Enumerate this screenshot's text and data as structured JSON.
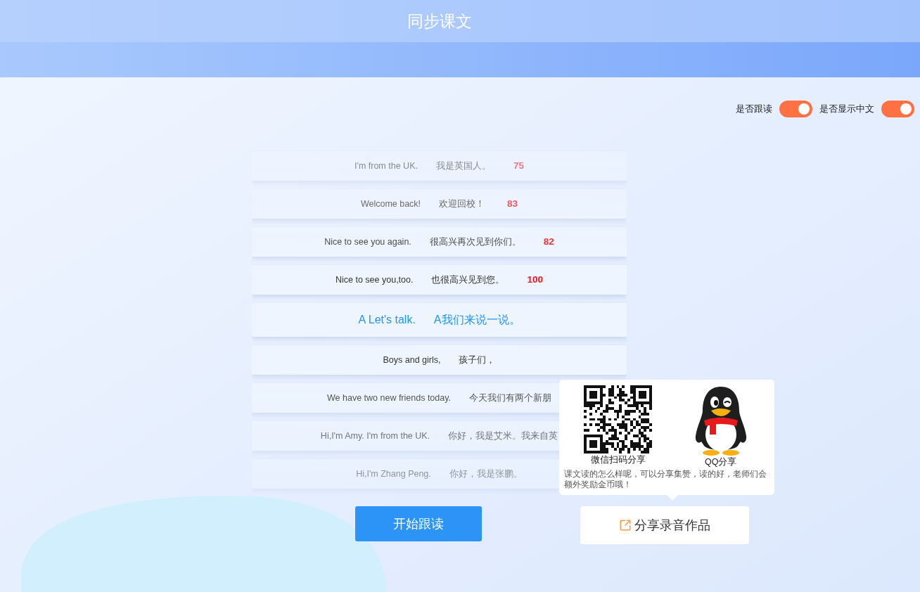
{
  "header": {
    "title": "同步课文"
  },
  "toggles": [
    {
      "label": "是否跟读",
      "on": true
    },
    {
      "label": "是否显示中文",
      "on": true
    }
  ],
  "lines": [
    {
      "kind": "sentence",
      "en": "I'm from the UK.",
      "zh": "我是英国人。",
      "score": "75"
    },
    {
      "kind": "sentence",
      "en": "Welcome back!",
      "zh": "欢迎回校！",
      "score": "83"
    },
    {
      "kind": "sentence",
      "en": "Nice to see you again.",
      "zh": "很高兴再次见到你们。",
      "score": "82"
    },
    {
      "kind": "sentence",
      "en": "Nice to see you,too.",
      "zh": "也很高兴见到您。",
      "score": "100"
    },
    {
      "kind": "heading",
      "en": "A Let's talk.",
      "zh": "A我们来说一说。"
    },
    {
      "kind": "sentence",
      "en": "Boys and girls,",
      "zh": "孩子们，"
    },
    {
      "kind": "sentence",
      "en": "We have two new friends today.",
      "zh": "今天我们有两个新朋"
    },
    {
      "kind": "sentence",
      "en": "Hi,I'm Amy. I'm from the UK.",
      "zh": "你好，我是艾米。我来自英"
    },
    {
      "kind": "sentence",
      "en": "Hi,I'm Zhang Peng.",
      "zh": "你好，我是张鹏。"
    }
  ],
  "share_popup": {
    "options": [
      {
        "kind": "qr",
        "label": "微信扫码分享"
      },
      {
        "kind": "qq",
        "label": "QQ分享"
      }
    ],
    "note": "课文读的怎么样呢，可以分享集赞，读的好，老师们会额外奖励金币哦！"
  },
  "buttons": {
    "start": "开始跟读",
    "share": "分享录音作品"
  }
}
